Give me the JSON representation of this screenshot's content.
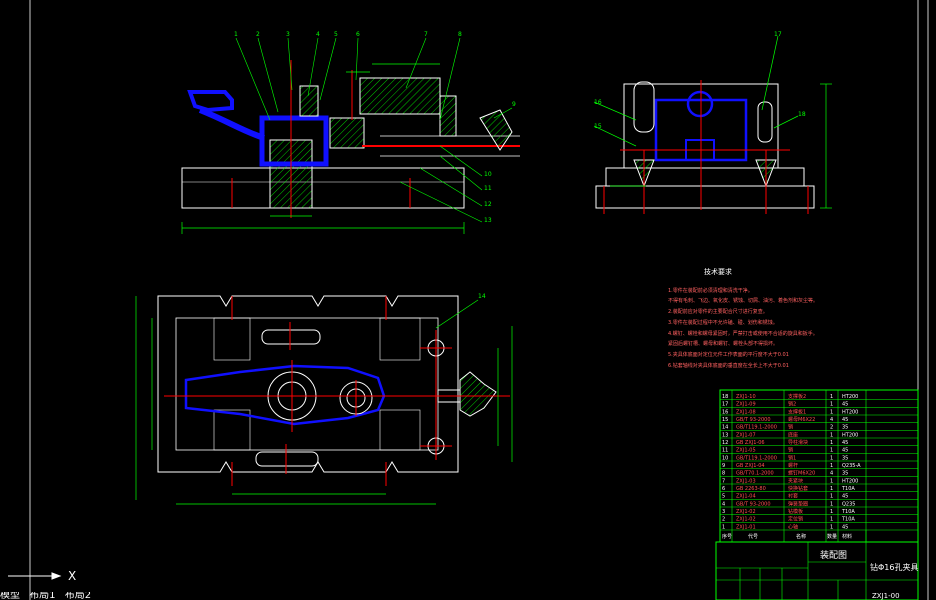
{
  "colors": {
    "background": "#000000",
    "outline": "#ffffff",
    "dimension": "#00ff00",
    "centerline": "#ff0000",
    "hatch": "#00ff00",
    "highlight_part": "#1010ff",
    "leader": "#ffff00"
  },
  "front_view": {
    "balloons": [
      "1",
      "2",
      "3",
      "4",
      "5",
      "6",
      "7",
      "8",
      "9",
      "10",
      "11",
      "12",
      "13"
    ]
  },
  "side_view": {
    "balloons": [
      "15",
      "16",
      "17",
      "18"
    ]
  },
  "top_view": {
    "balloons": [
      "14"
    ]
  },
  "tech_requirements": {
    "title": "技术要求",
    "lines": [
      "1.零件在装配前必须清理和清洗干净。",
      "  不得有毛刺、飞边、氧化皮、锈蚀、切屑、油污、着色剂和灰尘等。",
      "2.装配前应对零件的主要配合尺寸进行复查。",
      "3.零件在装配过程中不允许磕、碰、划伤和锈蚀。",
      "4.螺钉、螺栓和螺母紧固时，严禁打击或使用不合适的旋具和扳手。",
      "  紧固后螺钉槽、螺母和螺钉、螺栓头部不得损坏。",
      "5.夹具体底面对定位元件工作表面的平行度不大于0.01",
      "6.钻套轴线对夹具体底面的垂直度在全长上不大于0.01"
    ]
  },
  "parts_list": {
    "rows": [
      {
        "no": "18",
        "code": "ZXJ1-10",
        "name": "支撑板2",
        "qty": "1",
        "mat": "HT200"
      },
      {
        "no": "17",
        "code": "ZXJ1-09",
        "name": "销2",
        "qty": "1",
        "mat": "45"
      },
      {
        "no": "16",
        "code": "ZXJ1-08",
        "name": "支撑板1",
        "qty": "1",
        "mat": "HT200"
      },
      {
        "no": "15",
        "code": "GB/T 93-2000",
        "name": "螺母M6X22",
        "qty": "4",
        "mat": "45"
      },
      {
        "no": "14",
        "code": "GB/T119.1-2000",
        "name": "销",
        "qty": "2",
        "mat": "35"
      },
      {
        "no": "13",
        "code": "ZXJ1-07",
        "name": "底座",
        "qty": "1",
        "mat": "HT200"
      },
      {
        "no": "12",
        "code": "GB ZXJ1-06",
        "name": "导柱滑块",
        "qty": "1",
        "mat": "45"
      },
      {
        "no": "11",
        "code": "ZXJ1-05",
        "name": "销",
        "qty": "1",
        "mat": "45"
      },
      {
        "no": "10",
        "code": "GB/T119.1-2000",
        "name": "销1",
        "qty": "1",
        "mat": "35"
      },
      {
        "no": "9",
        "code": "GB ZXJ1-04",
        "name": "螺杆",
        "qty": "1",
        "mat": "Q235-A"
      },
      {
        "no": "8",
        "code": "GB/T70.1-2000",
        "name": "螺钉M6X20",
        "qty": "4",
        "mat": "35"
      },
      {
        "no": "7",
        "code": "ZXJ1-03",
        "name": "夹紧块",
        "qty": "1",
        "mat": "HT200"
      },
      {
        "no": "6",
        "code": "GB 2263-80",
        "name": "快换钻套",
        "qty": "1",
        "mat": "T10A"
      },
      {
        "no": "5",
        "code": "ZXJ1-04",
        "name": "衬套",
        "qty": "1",
        "mat": "45"
      },
      {
        "no": "4",
        "code": "GB/T 93-2000",
        "name": "弹簧垫圈",
        "qty": "1",
        "mat": "Q235"
      },
      {
        "no": "3",
        "code": "ZXJ1-02",
        "name": "钻模板",
        "qty": "1",
        "mat": "T10A"
      },
      {
        "no": "2",
        "code": "ZXJ1-02",
        "name": "定位销",
        "qty": "1",
        "mat": "T10A"
      },
      {
        "no": "1",
        "code": "ZXJ1-01",
        "name": "心轴",
        "qty": "1",
        "mat": "45"
      }
    ]
  },
  "title_block": {
    "drawing_type": "装配图",
    "part_name": "钻Φ16孔夹具",
    "drawing_no": "ZXJ1-00",
    "header_no": "序号",
    "header_code": "代号",
    "header_name": "名称",
    "header_qty": "数量",
    "header_mat": "材料"
  },
  "ucs": {
    "x_label": "X"
  },
  "command_strip": {
    "tabs": [
      "模型",
      "布局1",
      "布局2"
    ]
  }
}
